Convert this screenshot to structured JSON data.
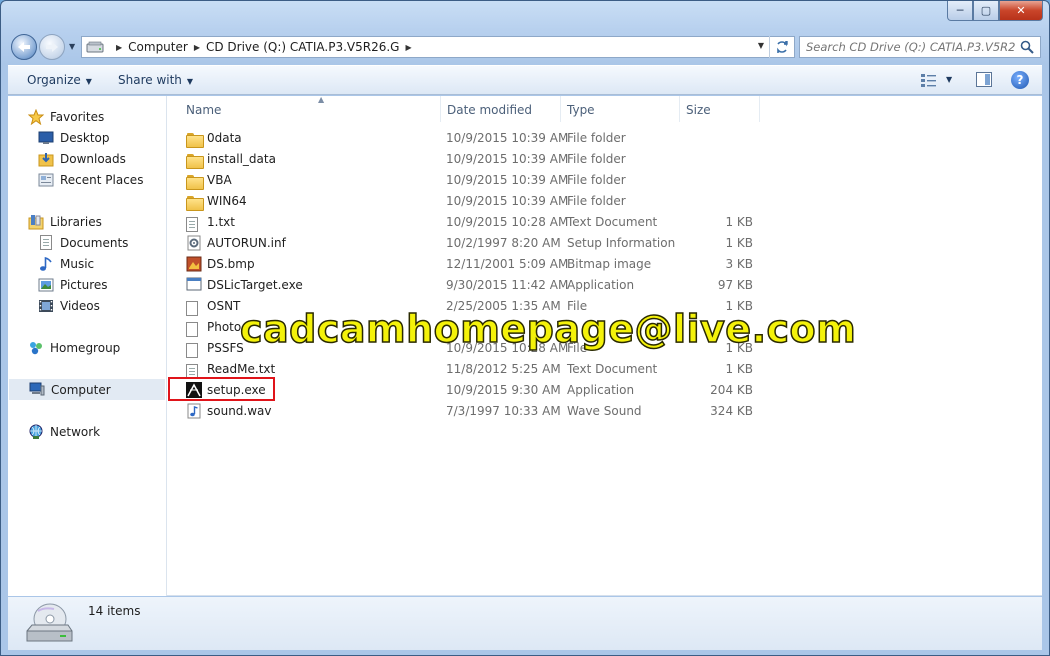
{
  "window": {
    "caption": {
      "min": "─",
      "max": "▢",
      "close": "✕"
    }
  },
  "address": {
    "crumbs": [
      "Computer",
      "CD Drive (Q:) CATIA.P3.V5R26.G"
    ],
    "search_placeholder": "Search CD Drive (Q:) CATIA.P3.V5R26.G"
  },
  "toolbar": {
    "organize_label": "Organize",
    "share_label": "Share with",
    "help_label": "?"
  },
  "sidebar": {
    "favorites": {
      "label": "Favorites",
      "items": [
        "Desktop",
        "Downloads",
        "Recent Places"
      ]
    },
    "libraries": {
      "label": "Libraries",
      "items": [
        "Documents",
        "Music",
        "Pictures",
        "Videos"
      ]
    },
    "homegroup": "Homegroup",
    "computer": "Computer",
    "network": "Network"
  },
  "columns": {
    "name": "Name",
    "date": "Date modified",
    "type": "Type",
    "size": "Size"
  },
  "files": [
    {
      "name": "0data",
      "date": "10/9/2015 10:39 AM",
      "type": "File folder",
      "size": "",
      "icon": "folder-icon"
    },
    {
      "name": "install_data",
      "date": "10/9/2015 10:39 AM",
      "type": "File folder",
      "size": "",
      "icon": "folder-icon"
    },
    {
      "name": "VBA",
      "date": "10/9/2015 10:39 AM",
      "type": "File folder",
      "size": "",
      "icon": "folder-icon"
    },
    {
      "name": "WIN64",
      "date": "10/9/2015 10:39 AM",
      "type": "File folder",
      "size": "",
      "icon": "folder-icon"
    },
    {
      "name": "1.txt",
      "date": "10/9/2015 10:28 AM",
      "type": "Text Document",
      "size": "1 KB",
      "icon": "text-file-icon"
    },
    {
      "name": "AUTORUN.inf",
      "date": "10/2/1997 8:20 AM",
      "type": "Setup Information",
      "size": "1 KB",
      "icon": "setup-info-icon"
    },
    {
      "name": "DS.bmp",
      "date": "12/11/2001 5:09 AM",
      "type": "Bitmap image",
      "size": "3 KB",
      "icon": "bitmap-icon"
    },
    {
      "name": "DSLicTarget.exe",
      "date": "9/30/2015 11:42 AM",
      "type": "Application",
      "size": "97 KB",
      "icon": "application-icon"
    },
    {
      "name": "OSNT",
      "date": "2/25/2005 1:35 AM",
      "type": "File",
      "size": "1 KB",
      "icon": "file-icon"
    },
    {
      "name": "Photo",
      "date": "",
      "type": "",
      "size": "",
      "icon": "file-icon"
    },
    {
      "name": "PSSFS",
      "date": "10/9/2015 10:28 AM",
      "type": "File",
      "size": "1 KB",
      "icon": "file-icon"
    },
    {
      "name": "ReadMe.txt",
      "date": "11/8/2012 5:25 AM",
      "type": "Text Document",
      "size": "1 KB",
      "icon": "text-file-icon"
    },
    {
      "name": "setup.exe",
      "date": "10/9/2015 9:30 AM",
      "type": "Application",
      "size": "204 KB",
      "icon": "setup-app-icon",
      "highlighted": true
    },
    {
      "name": "sound.wav",
      "date": "7/3/1997 10:33 AM",
      "type": "Wave Sound",
      "size": "324 KB",
      "icon": "audio-file-icon"
    }
  ],
  "watermark": "cadcamhomepage@live.com",
  "status": {
    "item_count": "14 items"
  },
  "colors": {
    "highlight_box": "#e0141a",
    "watermark": "#f4f20a"
  }
}
